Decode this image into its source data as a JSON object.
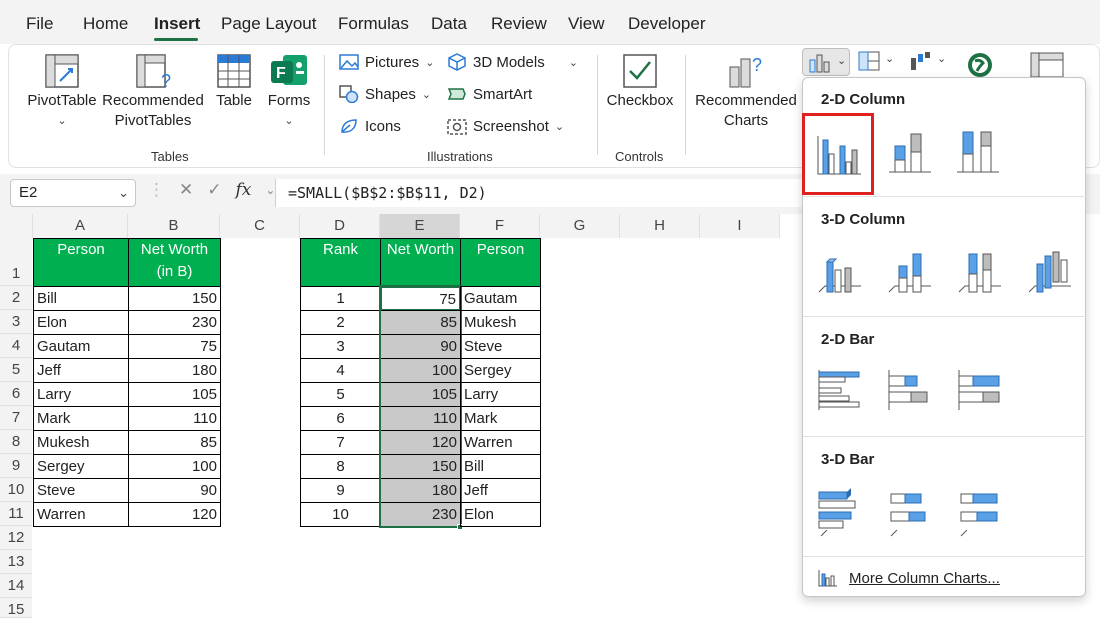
{
  "menu": {
    "tabs": [
      {
        "label": "File"
      },
      {
        "label": "Home"
      },
      {
        "label": "Insert"
      },
      {
        "label": "Page Layout"
      },
      {
        "label": "Formulas"
      },
      {
        "label": "Data"
      },
      {
        "label": "Review"
      },
      {
        "label": "View"
      },
      {
        "label": "Developer"
      }
    ],
    "active": "Insert"
  },
  "ribbon": {
    "tables": {
      "pivot": "PivotTable",
      "recommended_line1": "Recommended",
      "recommended_line2": "PivotTables",
      "table": "Table",
      "forms": "Forms",
      "group_label": "Tables"
    },
    "illustrations": {
      "pictures": "Pictures",
      "shapes": "Shapes",
      "icons": "Icons",
      "models": "3D Models",
      "smartart": "SmartArt",
      "screenshot": "Screenshot",
      "group_label": "Illustrations"
    },
    "controls": {
      "checkbox": "Checkbox",
      "group_label": "Controls"
    },
    "charts": {
      "recommended_line1": "Recommended",
      "recommended_line2": "Charts"
    }
  },
  "formula_bar": {
    "name_box": "E2",
    "formula": "=SMALL($B$2:$B$11, D2)",
    "fx": "fx"
  },
  "sheet": {
    "columns": [
      "A",
      "B",
      "C",
      "D",
      "E",
      "F",
      "G",
      "H",
      "I"
    ],
    "rows": [
      "1",
      "2",
      "3",
      "4",
      "5",
      "6",
      "7",
      "8",
      "9",
      "10",
      "11",
      "12",
      "13",
      "14",
      "15"
    ],
    "table1": {
      "header_person": "Person",
      "header_networth_line1": "Net Worth",
      "header_networth_line2": "(in B)",
      "rows": [
        {
          "person": "Bill",
          "worth": "150"
        },
        {
          "person": "Elon",
          "worth": "230"
        },
        {
          "person": "Gautam",
          "worth": "75"
        },
        {
          "person": "Jeff",
          "worth": "180"
        },
        {
          "person": "Larry",
          "worth": "105"
        },
        {
          "person": "Mark",
          "worth": "110"
        },
        {
          "person": "Mukesh",
          "worth": "85"
        },
        {
          "person": "Sergey",
          "worth": "100"
        },
        {
          "person": "Steve",
          "worth": "90"
        },
        {
          "person": "Warren",
          "worth": "120"
        }
      ]
    },
    "table2": {
      "header_rank": "Rank",
      "header_networth": "Net Worth",
      "header_person": "Person",
      "rows": [
        {
          "rank": "1",
          "worth": "75",
          "person": "Gautam"
        },
        {
          "rank": "2",
          "worth": "85",
          "person": "Mukesh"
        },
        {
          "rank": "3",
          "worth": "90",
          "person": "Steve"
        },
        {
          "rank": "4",
          "worth": "100",
          "person": "Sergey"
        },
        {
          "rank": "5",
          "worth": "105",
          "person": "Larry"
        },
        {
          "rank": "6",
          "worth": "110",
          "person": "Mark"
        },
        {
          "rank": "7",
          "worth": "120",
          "person": "Warren"
        },
        {
          "rank": "8",
          "worth": "150",
          "person": "Bill"
        },
        {
          "rank": "9",
          "worth": "180",
          "person": "Jeff"
        },
        {
          "rank": "10",
          "worth": "230",
          "person": "Elon"
        }
      ]
    }
  },
  "dropdown": {
    "section_2d_column": "2-D Column",
    "section_3d_column": "3-D Column",
    "section_2d_bar": "2-D Bar",
    "section_3d_bar": "3-D Bar",
    "more_link": "More Column Charts..."
  },
  "colors": {
    "header_green": "#00b050",
    "accent_green": "#1e7145",
    "selection_gray": "#c8c8c8",
    "highlight_red": "#e02020",
    "chart_blue": "#5aa0e6"
  }
}
